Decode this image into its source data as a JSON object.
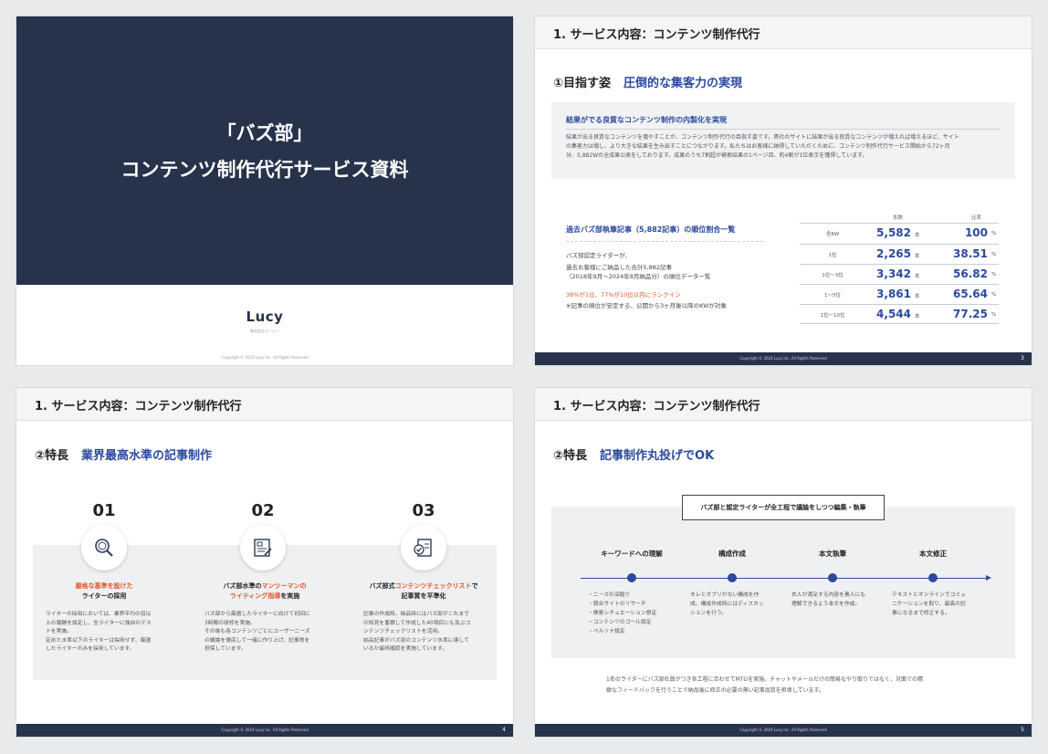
{
  "slide1": {
    "title_line1": "「バズ部」",
    "title_line2": "コンテンツ制作代行サービス資料",
    "logo": "Lucy",
    "company": "株式会社ルーシー",
    "copyright": "Copyright © 2024 Lucy Inc. All Rights Reserved"
  },
  "slide2": {
    "header": "1.  サービス内容：コンテンツ制作代行",
    "sub_label": "①目指す姿",
    "sub_highlight": "圧倒的な集客力の実現",
    "box_title": "結果がでる良質なコンテンツ制作の内製化を実現",
    "box_body1": "結果が出る良質なコンテンツを増やすことが、コンテンツ制作代行の目指す姿です。貴社のサイトに結果が出る良質なコンテンツが増えれば増えるほど、サイト",
    "box_body2": "の集客力は増し、より大きな結果を生み出すことにつながります。私たちはお客様に納得していただくために、コンテンツ制作代行サービス開始から72ヶ月",
    "box_body3": "分、5,882Wの全成果公表をしております。成果のうち7割超が検索結果の1ページ目、約4割が1位表示を獲得しています。",
    "rank_title": "過去バズ部執筆記事（5,882記事）の順位割合一覧",
    "rank_line1": "バズ部認定ライターが、",
    "rank_line2": "過去お客様にご納品した合計5,882記事",
    "rank_line3": "（2018年9月〜2024年8月納品分）の順位データ一覧",
    "rank_red": "38%が1位、77%が10位以内にランクイン",
    "rank_note": "※記事の順位が安定する、公開から3ヶ月後以降のKWが対象",
    "col_count": "本数",
    "col_ratio": "比率",
    "rows": [
      {
        "label": "全KW",
        "count": "5,582",
        "unit": "本",
        "ratio": "100",
        "pct": "%"
      },
      {
        "label": "1位",
        "count": "2,265",
        "unit": "本",
        "ratio": "38.51",
        "pct": "%"
      },
      {
        "label": "1位〜3位",
        "count": "3,342",
        "unit": "本",
        "ratio": "56.82",
        "pct": "%"
      },
      {
        "label": "1〜5位",
        "count": "3,861",
        "unit": "本",
        "ratio": "65.64",
        "pct": "%"
      },
      {
        "label": "1位〜10位",
        "count": "4,544",
        "unit": "本",
        "ratio": "77.25",
        "pct": "%"
      }
    ],
    "copyright": "Copyright © 2024 Lucy Inc. All Rights Reserved",
    "page": "3"
  },
  "slide3": {
    "header": "1.  サービス内容：コンテンツ制作代行",
    "sub_label": "②特長",
    "sub_highlight": "業界最高水準の記事制作",
    "f1": {
      "num": "01",
      "h_orange": "厳格な基準を設けた",
      "h_plain": "ライターの採用",
      "b1": "ライターの採用においては、業界平均の倍以",
      "b2": "上の報酬を設定し、全ライターに独自のテス",
      "b3": "トを実施。",
      "b4": "定めた水準以下のライターは採用せず、厳選",
      "b5": "したライターのみを採用しています。"
    },
    "f2": {
      "num": "02",
      "h_a": "バズ部水準の",
      "h_b": "マンツーマンの",
      "h_c": "ライティング指導",
      "h_d": "を実施",
      "b1": "バズ部から厳選したライターに向けて初回に",
      "b2": "3時間の研修を実施。",
      "b3": "その後も各コンテンツごとにユーザーニーズ",
      "b4": "の議論を徹底して一緒に作り上げ、記事質を",
      "b5": "担保しています。"
    },
    "f3": {
      "num": "03",
      "h_a": "バズ部式",
      "h_b": "コンテンツチェックリスト",
      "h_c": "で",
      "h_d": "記事質を平準化",
      "b1": "記事の作成時、納品時にはバズ部がこれまで",
      "b2": "の知見を蓄積して作成した40項目にも及ぶコ",
      "b3": "ンテンツチェックリストを活用。",
      "b4": "納品記事がバズ部のコンテンツ水準に達して",
      "b5": "いるか最終確認を実施しています。"
    },
    "copyright": "Copyright © 2024 Lucy Inc. All Rights Reserved",
    "page": "4"
  },
  "slide4": {
    "header": "1.  サービス内容：コンテンツ制作代行",
    "sub_label": "②特長",
    "sub_highlight": "記事制作丸投げでOK",
    "top_box": "バズ部と認定ライターが全工程で議論をしつつ編集・執筆",
    "steps": [
      {
        "title": "キーワードへの理解",
        "l1": "・ニーズの深掘り",
        "l2": "・競合サイトのリサーチ",
        "l3": "・検索シチュエーション想定",
        "l4": "・コンテンツのゴール設定",
        "l5": "・ペルソナ設定"
      },
      {
        "title": "構成作成",
        "l1": "モレとダブリがない構成を作",
        "l2": "成。構成作成時にはディスカッ",
        "l3": "ションを行う。",
        "l4": "",
        "l5": ""
      },
      {
        "title": "本文執筆",
        "l1": "玄人が満足する内容を素人にも",
        "l2": "理解できるよう本文を作成。",
        "l3": "",
        "l4": "",
        "l5": ""
      },
      {
        "title": "本文修正",
        "l1": "テキストとオンラインでコミュ",
        "l2": "ニケーションを取り、最高の記",
        "l3": "事になるまで修正する。",
        "l4": "",
        "l5": ""
      }
    ],
    "bottom1": "1名のライターにバズ部社員がつき各工程に合わせてMTGを実施。チャットやメールだけの簡易なやり取りではなく、対面での精",
    "bottom2": "緻なフィードバックを行うことで納品後に修正の必要の無い記事品質を担保しています。",
    "copyright": "Copyright © 2024 Lucy Inc. All Rights Reserved",
    "page": "5"
  }
}
